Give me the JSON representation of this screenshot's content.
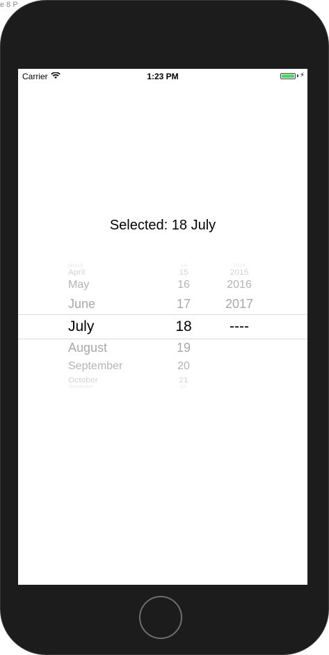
{
  "window": {
    "title_fragment": "e 8 P"
  },
  "status_bar": {
    "carrier": "Carrier",
    "time": "1:23 PM",
    "battery_color": "#4cd964"
  },
  "selection": {
    "label": "Selected: 18 July"
  },
  "picker": {
    "months": [
      "March",
      "April",
      "May",
      "June",
      "July",
      "August",
      "September",
      "October",
      "November"
    ],
    "days": [
      "14",
      "15",
      "16",
      "17",
      "18",
      "19",
      "20",
      "21",
      "22"
    ],
    "years": [
      "2014",
      "2015",
      "2016",
      "2017",
      "----"
    ],
    "selected": {
      "month": "July",
      "day": "18",
      "year": "----"
    }
  }
}
